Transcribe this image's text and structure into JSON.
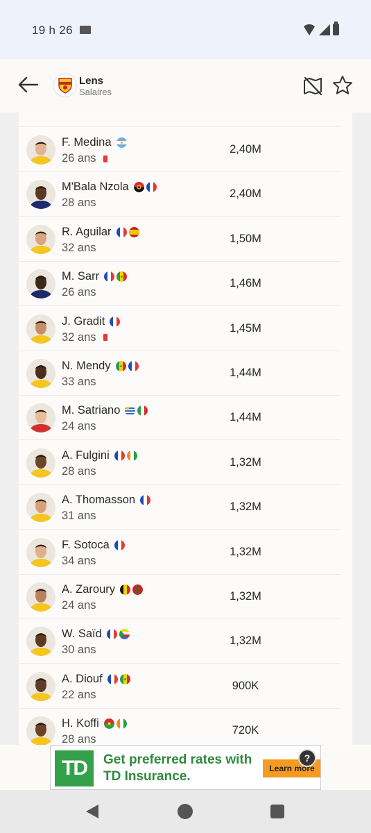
{
  "status": {
    "time": "19 h 26"
  },
  "header": {
    "club": "Lens",
    "subtitle": "Salaires"
  },
  "players": [
    {
      "name": "F. Medina",
      "age": "26 ans",
      "salary": "2,40M",
      "flags": [
        "ar"
      ],
      "red_card": true,
      "shirt": "#f4c61f"
    },
    {
      "name": "M'Bala Nzola",
      "age": "28 ans",
      "salary": "2,40M",
      "flags": [
        "ao",
        "fr"
      ],
      "red_card": false,
      "shirt": "#1e2a6e"
    },
    {
      "name": "R. Aguilar",
      "age": "32 ans",
      "salary": "1,50M",
      "flags": [
        "fr",
        "es"
      ],
      "red_card": false,
      "shirt": "#f4c61f"
    },
    {
      "name": "M. Sarr",
      "age": "26 ans",
      "salary": "1,46M",
      "flags": [
        "fr",
        "sn"
      ],
      "red_card": false,
      "shirt": "#1e2a6e"
    },
    {
      "name": "J. Gradit",
      "age": "32 ans",
      "salary": "1,45M",
      "flags": [
        "fr"
      ],
      "red_card": true,
      "shirt": "#f4c61f"
    },
    {
      "name": "N. Mendy",
      "age": "33 ans",
      "salary": "1,44M",
      "flags": [
        "sn",
        "fr"
      ],
      "red_card": false,
      "shirt": "#f4c61f"
    },
    {
      "name": "M. Satriano",
      "age": "24 ans",
      "salary": "1,44M",
      "flags": [
        "uy",
        "it"
      ],
      "red_card": false,
      "shirt": "#d32f2f"
    },
    {
      "name": "A. Fulgini",
      "age": "28 ans",
      "salary": "1,32M",
      "flags": [
        "fr",
        "ci"
      ],
      "red_card": false,
      "shirt": "#f4c61f"
    },
    {
      "name": "A. Thomasson",
      "age": "31 ans",
      "salary": "1,32M",
      "flags": [
        "fr"
      ],
      "red_card": false,
      "shirt": "#f4c61f"
    },
    {
      "name": "F. Sotoca",
      "age": "34 ans",
      "salary": "1,32M",
      "flags": [
        "fr"
      ],
      "red_card": false,
      "shirt": "#f4c61f"
    },
    {
      "name": "A. Zaroury",
      "age": "24 ans",
      "salary": "1,32M",
      "flags": [
        "be",
        "ma"
      ],
      "red_card": false,
      "shirt": "#f4c61f"
    },
    {
      "name": "W. Saïd",
      "age": "30 ans",
      "salary": "1,32M",
      "flags": [
        "fr",
        "km"
      ],
      "red_card": false,
      "shirt": "#f4c61f"
    },
    {
      "name": "A. Diouf",
      "age": "22 ans",
      "salary": "900K",
      "flags": [
        "fr",
        "sn"
      ],
      "red_card": false,
      "shirt": "#f4c61f"
    },
    {
      "name": "H. Koffi",
      "age": "28 ans",
      "salary": "720K",
      "flags": [
        "bf",
        "ci"
      ],
      "red_card": false,
      "shirt": "#f4c61f"
    }
  ],
  "ad": {
    "logo": "TD",
    "headline": "Get preferred rates with TD Insurance.",
    "cta": "Learn more",
    "help": "?"
  },
  "colors": {
    "header_bg": "#fbfaf7",
    "status_bg": "#eef2fa",
    "ad_green": "#2e8b3c",
    "ad_cta": "#f59b22",
    "td_green": "#34a14a"
  },
  "icons": {
    "back": "arrow-left-icon",
    "map": "map-off-icon",
    "favorite": "star-outline-icon"
  }
}
